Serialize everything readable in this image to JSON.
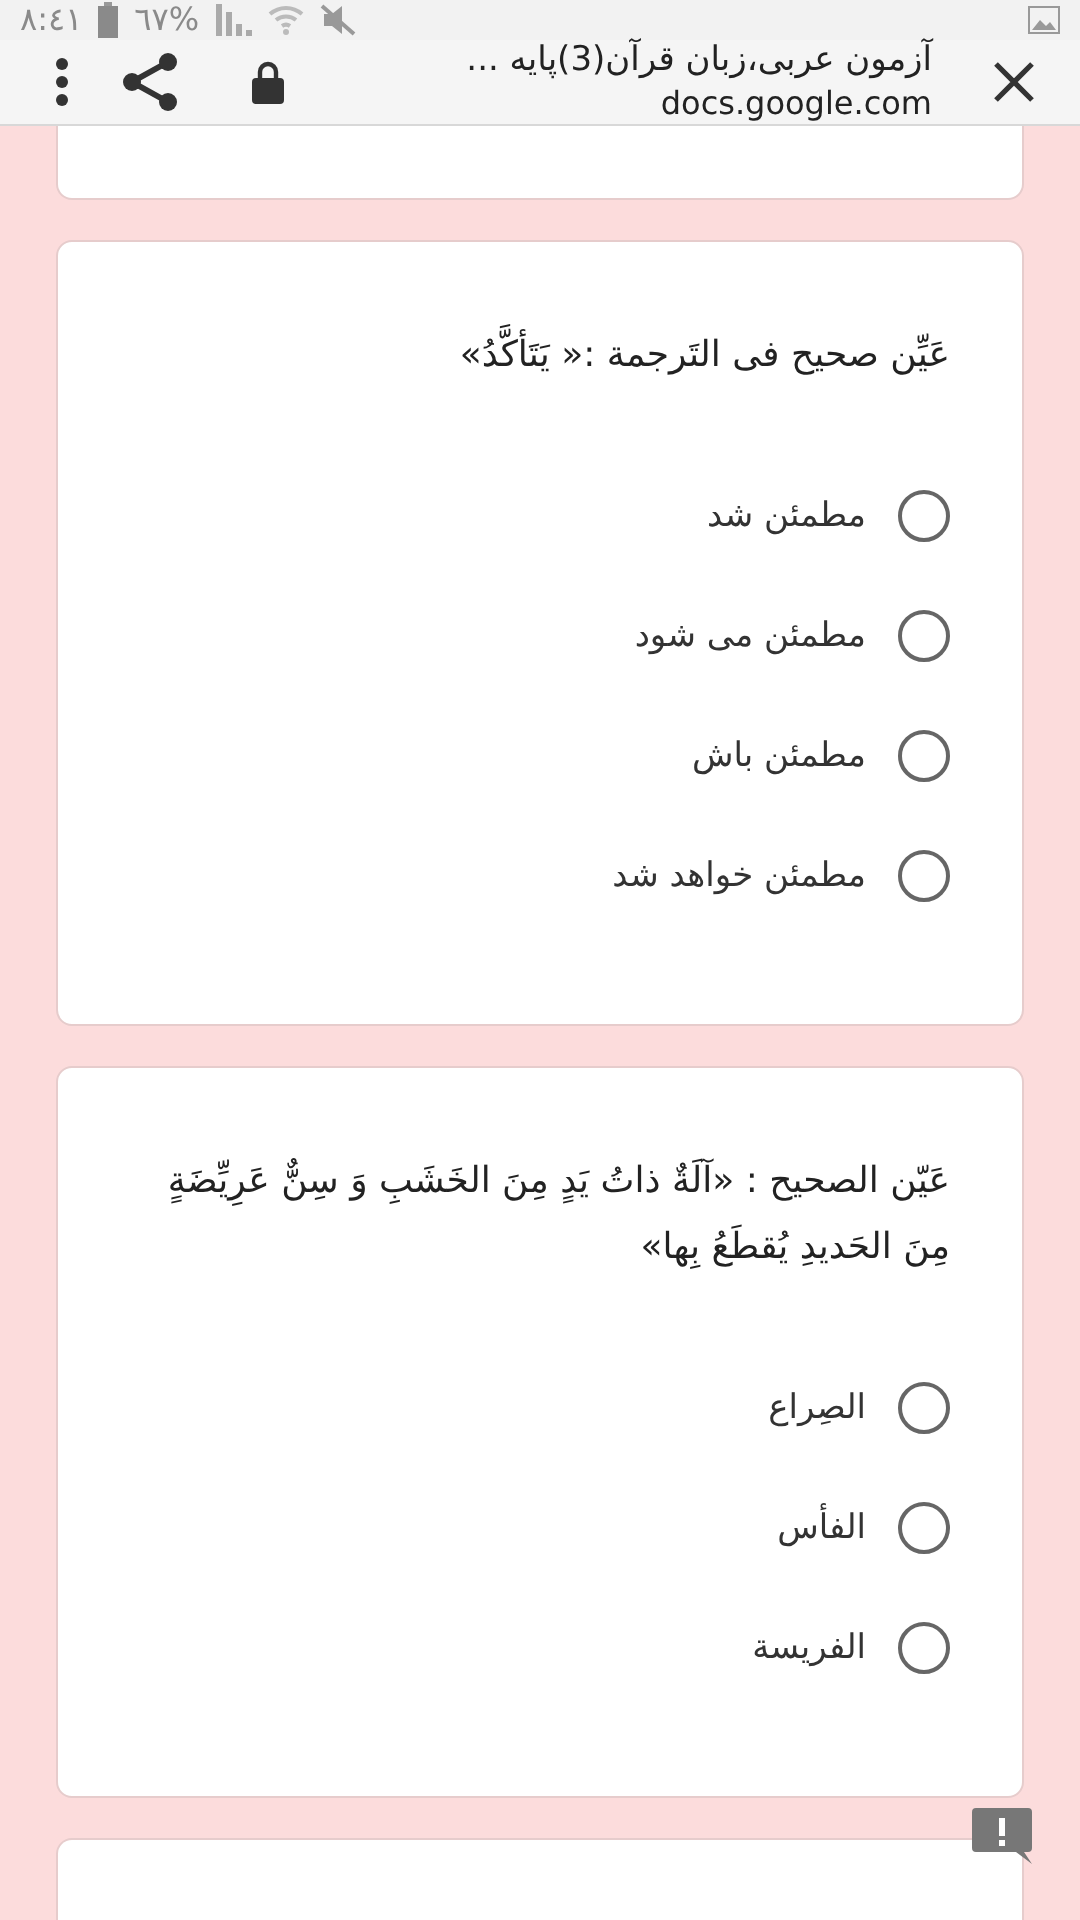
{
  "status_bar": {
    "time": "٨:٤١",
    "battery": "٦٧%"
  },
  "browser_bar": {
    "title": "آزمون عربی،زبان قرآن(3)پایه ...",
    "url": "docs.google.com"
  },
  "questions": [
    {
      "text": "عَیِّن صحیح فی التَرجمة :« يَتَأكَّدُ»",
      "options": [
        {
          "label": "مطمئن شد",
          "selected": false
        },
        {
          "label": "مطمئن می شود",
          "selected": false
        },
        {
          "label": "مطمئن باش",
          "selected": false
        },
        {
          "label": "مطمئن خواهد شد",
          "selected": false
        }
      ]
    },
    {
      "text": "عَيّن الصحيح : «آلَةٌ ذاتُ يَدٍ مِنَ الخَشَبِ وَ سِنٌّ عَرِيِّضَةٍ مِنَ الحَديدِ يُقطَعُ بِها»",
      "options": [
        {
          "label": "الصِراع",
          "selected": false
        },
        {
          "label": "الفأس",
          "selected": false
        },
        {
          "label": "الفريسة",
          "selected": false
        }
      ]
    }
  ]
}
